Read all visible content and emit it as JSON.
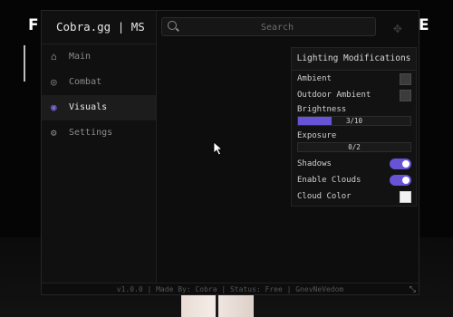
{
  "app": {
    "title": "Cobra.gg | MS"
  },
  "background": {
    "left_letter": "F",
    "right_letter": "E"
  },
  "search": {
    "placeholder": "Search"
  },
  "sidebar": {
    "items": [
      {
        "label": "Main",
        "icon": "home-icon",
        "active": false
      },
      {
        "label": "Combat",
        "icon": "target-icon",
        "active": false
      },
      {
        "label": "Visuals",
        "icon": "eye-icon",
        "active": true
      },
      {
        "label": "Settings",
        "icon": "gear-icon",
        "active": false
      }
    ]
  },
  "lighting": {
    "title": "Lighting Modifications",
    "ambient_label": "Ambient",
    "outdoor_ambient_label": "Outdoor Ambient",
    "brightness": {
      "label": "Brightness",
      "value_text": "3/10",
      "value": 3,
      "max": 10
    },
    "exposure": {
      "label": "Exposure",
      "value_text": "0/2",
      "value": 0,
      "max": 2
    },
    "shadows": {
      "label": "Shadows",
      "on": true
    },
    "enable_clouds": {
      "label": "Enable Clouds",
      "on": true
    },
    "cloud_color_label": "Cloud Color"
  },
  "colors": {
    "accent": "#6653d6",
    "ambient": "#3b3b3b",
    "cloud": "#f1f1f1"
  },
  "footer": {
    "text": "v1.0.0 | Made By: Cobra | Status: Free | GnevNeVedom"
  }
}
